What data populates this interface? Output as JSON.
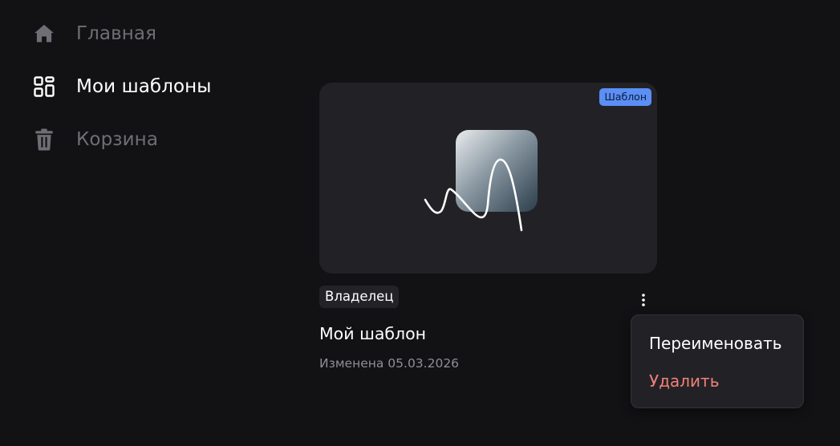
{
  "sidebar": {
    "items": [
      {
        "label": "Главная",
        "icon": "home-icon",
        "state": "inactive"
      },
      {
        "label": "Мои шаблоны",
        "icon": "grid-icon",
        "state": "active"
      },
      {
        "label": "Корзина",
        "icon": "trash-icon",
        "state": "inactive"
      }
    ]
  },
  "card": {
    "template_badge": "Шаблон",
    "owner_badge": "Владелец",
    "title": "Мой шаблон",
    "modified": "Изменена 05.03.2026",
    "more_icon": "more-vertical-icon"
  },
  "context_menu": {
    "rename": "Переименовать",
    "delete": "Удалить"
  },
  "colors": {
    "background": "#121214",
    "card": "#222226",
    "accent_badge": "#5b8ff5",
    "danger": "#f08078",
    "muted": "#6e6e74"
  }
}
